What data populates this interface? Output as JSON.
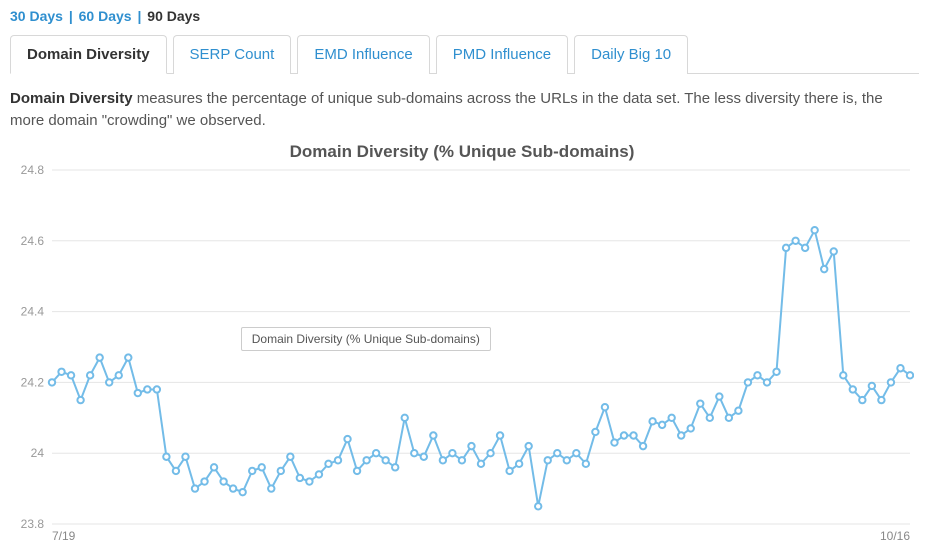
{
  "range_links": {
    "items": [
      "30 Days",
      "60 Days",
      "90 Days"
    ],
    "active_index": 2,
    "separator": "|"
  },
  "tabs": {
    "items": [
      "Domain Diversity",
      "SERP Count",
      "EMD Influence",
      "PMD Influence",
      "Daily Big 10"
    ],
    "active_index": 0
  },
  "description": {
    "bold_prefix": "Domain Diversity",
    "rest": " measures the percentage of unique sub-domains across the URLs in the data set. The less diversity there is, the more domain \"crowding\" we observed."
  },
  "legend_label": "Domain Diversity (% Unique Sub-domains)",
  "chart_data": {
    "type": "line",
    "title": "Domain Diversity (% Unique Sub-domains)",
    "ylim": [
      23.8,
      24.8
    ],
    "yticks": [
      23.8,
      24,
      24.2,
      24.4,
      24.6,
      24.8
    ],
    "x_start_label": "7/19",
    "x_end_label": "10/16",
    "series": [
      {
        "name": "Domain Diversity (% Unique Sub-domains)",
        "values": [
          24.2,
          24.23,
          24.22,
          24.15,
          24.22,
          24.27,
          24.2,
          24.22,
          24.27,
          24.17,
          24.18,
          24.18,
          23.99,
          23.95,
          23.99,
          23.9,
          23.92,
          23.96,
          23.92,
          23.9,
          23.89,
          23.95,
          23.96,
          23.9,
          23.95,
          23.99,
          23.93,
          23.92,
          23.94,
          23.97,
          23.98,
          24.04,
          23.95,
          23.98,
          24.0,
          23.98,
          23.96,
          24.1,
          24.0,
          23.99,
          24.05,
          23.98,
          24.0,
          23.98,
          24.02,
          23.97,
          24.0,
          24.05,
          23.95,
          23.97,
          24.02,
          23.85,
          23.98,
          24.0,
          23.98,
          24.0,
          23.97,
          24.06,
          24.13,
          24.03,
          24.05,
          24.05,
          24.02,
          24.09,
          24.08,
          24.1,
          24.05,
          24.07,
          24.14,
          24.1,
          24.16,
          24.1,
          24.12,
          24.2,
          24.22,
          24.2,
          24.23,
          24.58,
          24.6,
          24.58,
          24.63,
          24.52,
          24.57,
          24.22,
          24.18,
          24.15,
          24.19,
          24.15,
          24.2,
          24.24,
          24.22
        ]
      }
    ]
  }
}
